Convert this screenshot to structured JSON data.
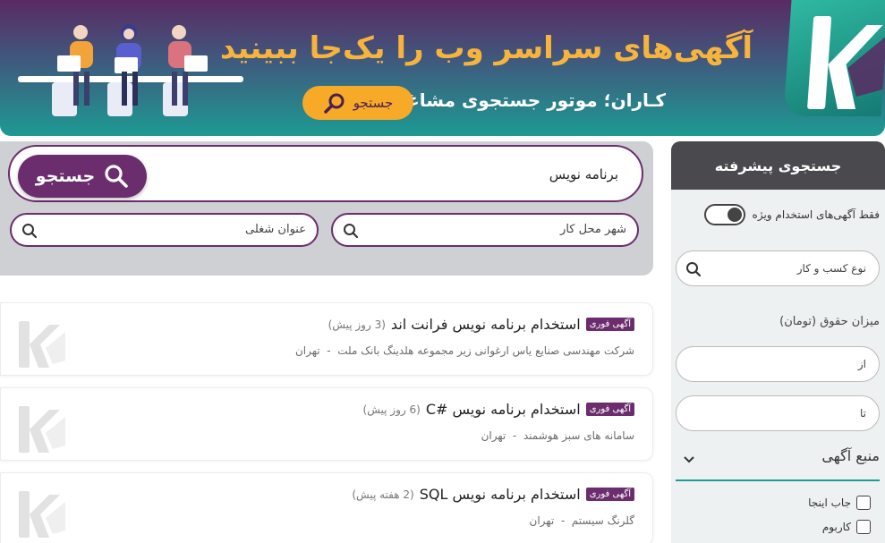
{
  "banner": {
    "title": "آگهی‌های سراسر وب را یک‌جا ببینید",
    "subtitle": "کـاران؛ موتور جستجوی مشاغل",
    "button_label": "جستجو"
  },
  "search": {
    "query": "برنامه نویس",
    "button_label": "جستجو",
    "city_placeholder": "شهر محل کار",
    "title_placeholder": "عنوان شغلی"
  },
  "listings": [
    {
      "badge": "آگهی فوری",
      "title": "استخدام برنامه نویس فرانت اند",
      "age": "(3 روز پیش)",
      "company": "شرکت مهندسی صنایع یاس ارغوانی زیر مجموعه هلدینگ بانک ملت",
      "city": "تهران"
    },
    {
      "badge": "آگهی فوری",
      "title": "استخدام برنامه نویس #C",
      "age": "(6 روز پیش)",
      "company": "سامانه های سبز هوشمند",
      "city": "تهران"
    },
    {
      "badge": "آگهی فوری",
      "title": "استخدام برنامه نویس SQL",
      "age": "(2 هفته پیش)",
      "company": "گلرنگ سیستم",
      "city": "تهران"
    }
  ],
  "separator": "-",
  "sidebar": {
    "header": "جستجوی پیشرفته",
    "featured_toggle_label": "فقط آگهی‌های استخدام ویژه",
    "featured_toggle_on": false,
    "business_type_placeholder": "نوع کسب و کار",
    "salary_label": "میزان حقوق (تومان)",
    "salary_from_placeholder": "از",
    "salary_to_placeholder": "تا",
    "source_label": "منبع آگهی",
    "sources": [
      {
        "label": "جاب اینجا",
        "checked": false
      },
      {
        "label": "کاربوم",
        "checked": false
      }
    ]
  },
  "colors": {
    "purple": "#6b2d6e",
    "orange": "#f7a928",
    "teal": "#1e9e93",
    "dark": "#4a4a4e"
  },
  "icons": {
    "search": "search-icon",
    "logo": "karan-logo-icon",
    "chevron": "chevron-down-icon"
  }
}
